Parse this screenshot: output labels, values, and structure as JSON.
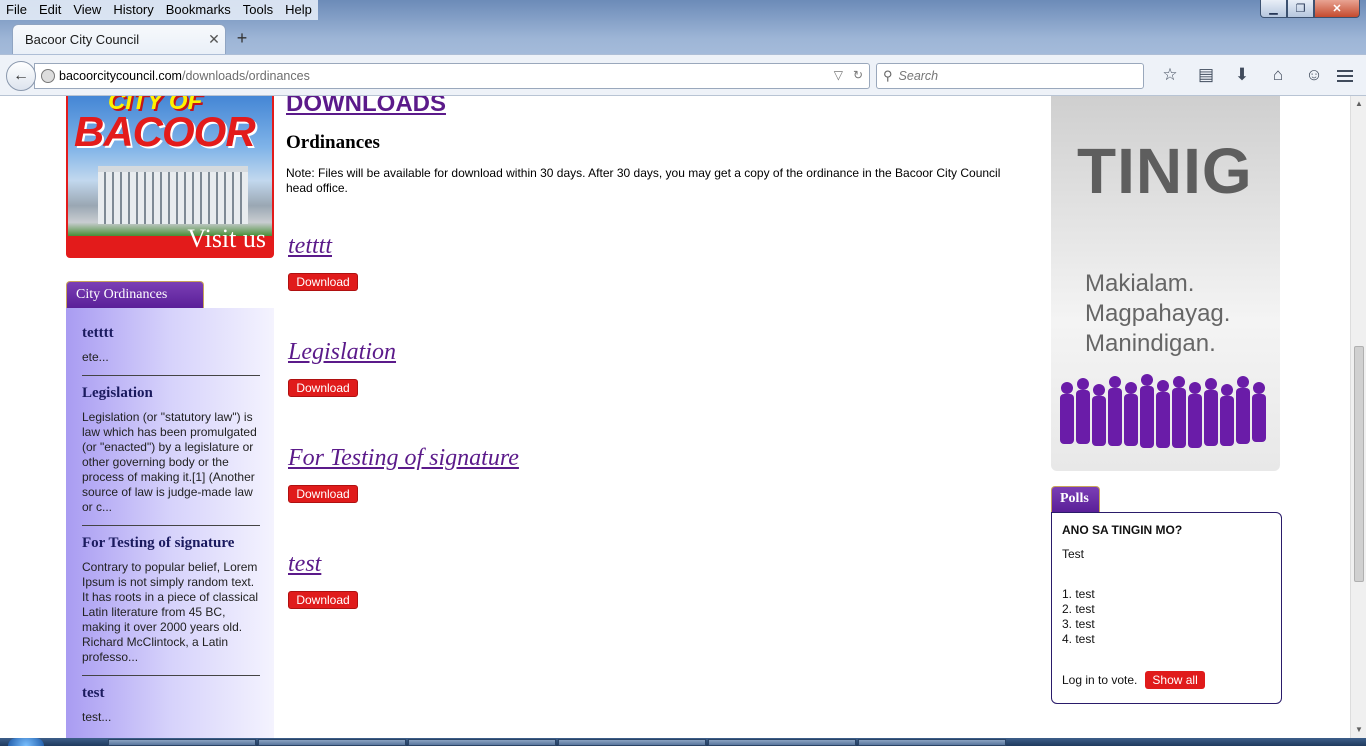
{
  "browser": {
    "menu": [
      "File",
      "Edit",
      "View",
      "History",
      "Bookmarks",
      "Tools",
      "Help"
    ],
    "tab_title": "Bacoor City Council",
    "new_tab": "+",
    "url_host": "bacoorcitycouncil.com",
    "url_path": "/downloads/ordinances",
    "search_placeholder": "Search"
  },
  "left": {
    "banner": {
      "line1": "CITY OF",
      "line2": "BACOOR",
      "cta": "Visit us"
    },
    "panel_title": "City Ordinances",
    "items": [
      {
        "title": "tetttt",
        "text": "ete..."
      },
      {
        "title": "Legislation",
        "text": "Legislation (or \"statutory law\") is law which has been promulgated (or \"enacted\") by a legislature or other governing body or the process of making it.[1] (Another source of law is judge-made law or c..."
      },
      {
        "title": "For Testing of signature",
        "text": "Contrary to popular belief, Lorem Ipsum is not simply random text. It has roots in a piece of classical Latin literature from 45 BC, making it over 2000 years old. Richard McClintock, a Latin professo..."
      },
      {
        "title": "test",
        "text": "test..."
      }
    ]
  },
  "main": {
    "heading": "DOWNLOADS",
    "subheading": "Ordinances",
    "note": "Note: Files will be available for download within 30 days. After 30 days, you may get a copy of the ordinance in the Bacoor City Council head office.",
    "download_label": "Download",
    "items": [
      "tetttt",
      "Legislation",
      "For Testing of signature",
      "test"
    ]
  },
  "right": {
    "banner": {
      "word": "TINIG",
      "lines": [
        "Makialam.",
        "Magpahayag.",
        "Manindigan."
      ]
    },
    "polls": {
      "tab": "Polls",
      "question": "ANO SA TINGIN MO?",
      "subtitle": "Test",
      "options": [
        "1. test",
        "2. test",
        "3. test",
        "4. test"
      ],
      "login_text": "Log in to vote.",
      "show_all": "Show all"
    }
  },
  "colors": {
    "accent_purple": "#5b1a8a",
    "button_red": "#e01b1b"
  }
}
